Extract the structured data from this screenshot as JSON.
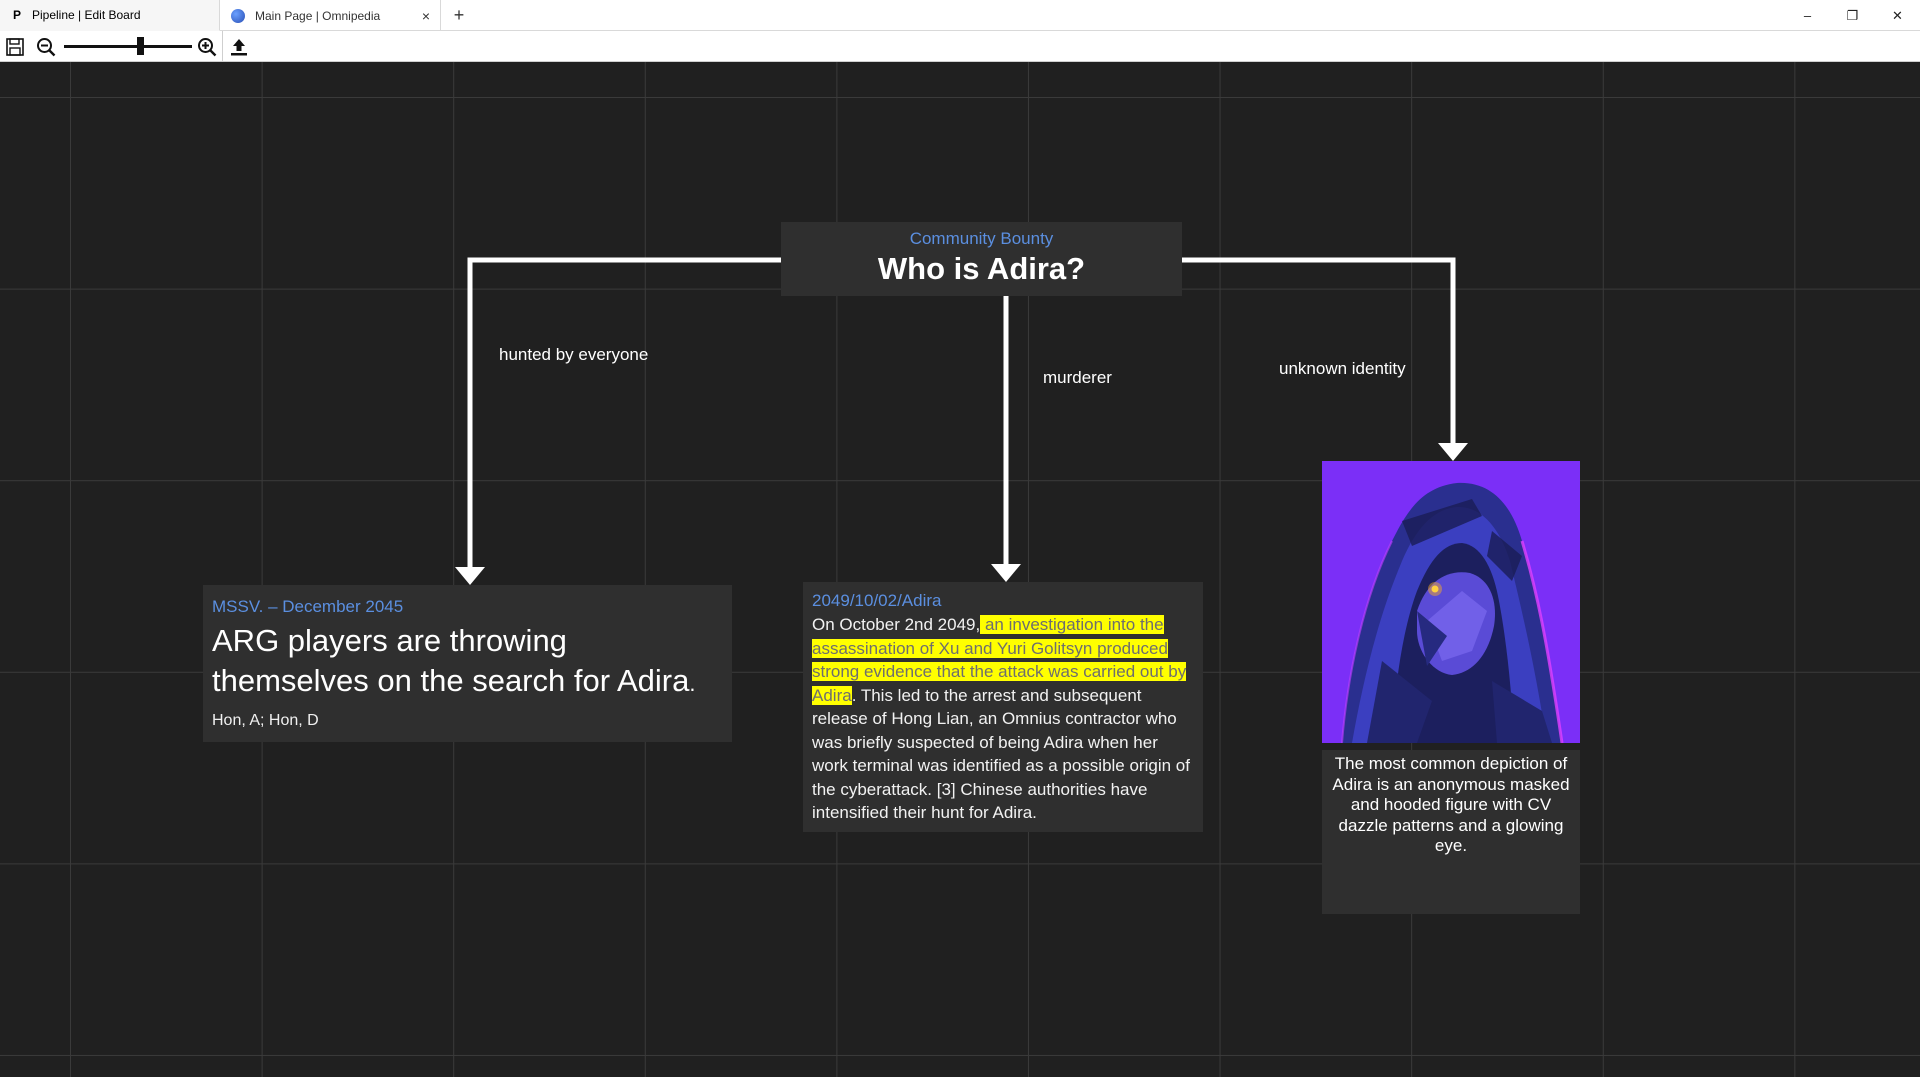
{
  "window": {
    "tabs": [
      {
        "label": "Pipeline | Edit Board",
        "icon": "pipeline-p-icon",
        "active": true
      },
      {
        "label": "Main Page | Omnipedia",
        "icon": "globe-icon",
        "active": false,
        "close": "×"
      }
    ],
    "new_tab": "+",
    "controls": {
      "minimize": "–",
      "restore": "❐",
      "close": "✕"
    }
  },
  "toolbar": {
    "zoom_level": 0.56
  },
  "board": {
    "root": {
      "subtitle": "Community Bounty",
      "title": "Who is Adira?"
    },
    "edges": [
      {
        "label": "hunted by everyone"
      },
      {
        "label": "murderer"
      },
      {
        "label": "unknown identity"
      }
    ],
    "news_card": {
      "date": "MSSV. – December 2045",
      "headline": "ARG players are throwing themselves on the search for Adira",
      "headline_end": ".",
      "authors": "Hon, A; Hon, D"
    },
    "article_card": {
      "heading": "2049/10/02/Adira",
      "text_pre": "On October 2nd 2049,",
      "text_highlight": " an investigation into the assassination of Xu and Yuri Golitsyn produced strong evidence that the attack was carried out by Adira",
      "text_post": ". This led to the arrest and subsequent release of Hong Lian, an Omnius contractor who was briefly suspected of being Adira when her work terminal was identified as a possible origin of the cyberattack. [3] Chinese authorities have intensified their hunt for Adira."
    },
    "image_card": {
      "caption": "The most common depiction of Adira is an anonymous masked and hooded figure with CV dazzle patterns and a glowing eye."
    }
  },
  "colors": {
    "canvas_bg": "#202020",
    "grid": "#3a3a3a",
    "node_bg": "#2f2f2f",
    "accent_blue": "#5b8fe0",
    "highlight": "#ffff00",
    "image_bg": "#7b2ff7"
  }
}
